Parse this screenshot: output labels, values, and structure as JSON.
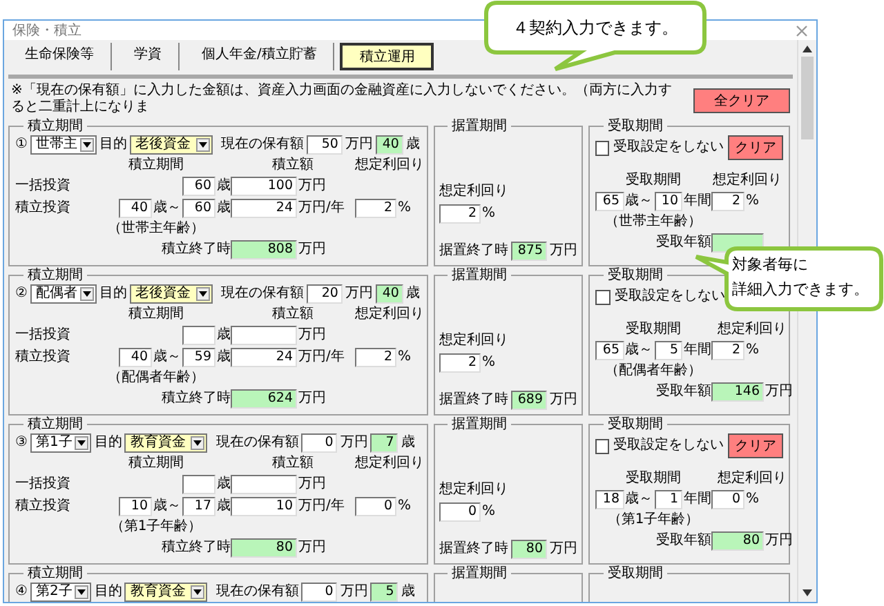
{
  "window": {
    "title": "保険・積立"
  },
  "tabs": [
    {
      "label": "生命保険等",
      "selected": false
    },
    {
      "label": "学資",
      "selected": false
    },
    {
      "label": "個人年金/積立貯蓄",
      "selected": false
    },
    {
      "label": "積立運用",
      "selected": true
    }
  ],
  "notice": "※「現在の保有額」に入力した金額は、資産入力画面の金融資産に入力しないでください。（両方に入力すると二重計上になりま",
  "clear_all_button": "全クリア",
  "plans": [
    {
      "number": "①",
      "accumulation": {
        "legend": "積立期間",
        "person": "世帯主",
        "purpose_label": "目的",
        "purpose": "老後資金",
        "holding_label": "現在の保有額",
        "holding": "50",
        "holding_unit": "万円",
        "age": "40",
        "age_unit": "歳",
        "headers": [
          "積立期間",
          "積立額",
          "想定利回り"
        ],
        "lump_label": "一括投資",
        "lump_age": "60",
        "lump_age_unit": "歳",
        "lump_amount": "100",
        "lump_amount_unit": "万円",
        "regular_label": "積立投資",
        "from": "40",
        "from_unit": "歳～",
        "to": "60",
        "to_unit": "歳",
        "amount": "24",
        "amount_unit": "万円/年",
        "rate": "2",
        "rate_unit": "%",
        "age_basis": "（世帯主年齢）",
        "end_label": "積立終了時",
        "end_value": "808",
        "end_unit": "万円"
      },
      "deferral": {
        "legend": "据置期間",
        "rate_label": "想定利回り",
        "rate": "2",
        "rate_unit": "%",
        "end_label": "据置終了時",
        "end_value": "875",
        "end_unit": "万円"
      },
      "receipt": {
        "legend": "受取期間",
        "no_receipt": {
          "label": "受取設定をしない",
          "checked": false
        },
        "clear_button": "クリア",
        "period_label": "受取期間",
        "rate_label": "想定利回り",
        "start": "65",
        "start_unit": "歳～",
        "years": "10",
        "years_unit": "年間",
        "rate": "2",
        "rate_unit": "%",
        "age_basis": "（世帯主年齢）",
        "amount_label": "受取年額"
      }
    },
    {
      "number": "②",
      "accumulation": {
        "legend": "積立期間",
        "person": "配偶者",
        "purpose_label": "目的",
        "purpose": "老後資金",
        "holding_label": "現在の保有額",
        "holding": "20",
        "holding_unit": "万円",
        "age": "40",
        "age_unit": "歳",
        "headers": [
          "積立期間",
          "積立額",
          "想定利回り"
        ],
        "lump_label": "一括投資",
        "lump_age_unit": "歳",
        "lump_amount_unit": "万円",
        "regular_label": "積立投資",
        "from": "40",
        "from_unit": "歳～",
        "to": "59",
        "to_unit": "歳",
        "amount": "24",
        "amount_unit": "万円/年",
        "rate": "2",
        "rate_unit": "%",
        "age_basis": "（配偶者年齢）",
        "end_label": "積立終了時",
        "end_value": "624",
        "end_unit": "万円"
      },
      "deferral": {
        "legend": "据置期間",
        "rate_label": "想定利回り",
        "rate": "2",
        "rate_unit": "%",
        "end_label": "据置終了時",
        "end_value": "689",
        "end_unit": "万円"
      },
      "receipt": {
        "legend": "受取期間",
        "no_receipt": {
          "label": "受取設定をしない",
          "checked": false
        },
        "period_label": "受取期間",
        "rate_label": "想定利回り",
        "start": "65",
        "start_unit": "歳～",
        "years": "5",
        "years_unit": "年間",
        "rate": "2",
        "rate_unit": "%",
        "age_basis": "（配偶者年齢）",
        "amount_label": "受取年額",
        "amount": "146",
        "amount_unit": "万円"
      }
    },
    {
      "number": "③",
      "accumulation": {
        "legend": "積立期間",
        "person": "第1子",
        "purpose_label": "目的",
        "purpose": "教育資金",
        "holding_label": "現在の保有額",
        "holding": "0",
        "holding_unit": "万円",
        "age": "7",
        "age_unit": "歳",
        "headers": [
          "積立期間",
          "積立額",
          "想定利回り"
        ],
        "lump_label": "一括投資",
        "lump_age_unit": "歳",
        "lump_amount_unit": "万円",
        "regular_label": "積立投資",
        "from": "10",
        "from_unit": "歳～",
        "to": "17",
        "to_unit": "歳",
        "amount": "10",
        "amount_unit": "万円/年",
        "rate": "0",
        "rate_unit": "%",
        "age_basis": "（第1子年齢）",
        "end_label": "積立終了時",
        "end_value": "80",
        "end_unit": "万円"
      },
      "deferral": {
        "legend": "据置期間",
        "rate_label": "想定利回り",
        "rate": "0",
        "rate_unit": "%",
        "end_label": "据置終了時",
        "end_value": "80",
        "end_unit": "万円"
      },
      "receipt": {
        "legend": "受取期間",
        "no_receipt": {
          "label": "受取設定をしない",
          "checked": false
        },
        "clear_button": "クリア",
        "period_label": "受取期間",
        "rate_label": "想定利回り",
        "start": "18",
        "start_unit": "歳～",
        "years": "1",
        "years_unit": "年間",
        "rate": "0",
        "rate_unit": "%",
        "age_basis": "（第1子年齢）",
        "amount_label": "受取年額",
        "amount": "80",
        "amount_unit": "万円"
      }
    },
    {
      "number": "④",
      "accumulation": {
        "legend": "積立期間",
        "person": "第2子",
        "purpose_label": "目的",
        "purpose": "教育資金",
        "holding_label": "現在の保有額",
        "holding": "0",
        "holding_unit": "万円",
        "age": "5",
        "age_unit": "歳"
      },
      "deferral": {
        "legend": "据置期間"
      },
      "receipt": {
        "legend": "受取期間"
      }
    }
  ],
  "callouts": [
    {
      "kind": "top",
      "lines": [
        "４契約入力できます。"
      ]
    },
    {
      "kind": "side",
      "lines": [
        "対象者毎に",
        "詳細入力できます。"
      ]
    }
  ]
}
